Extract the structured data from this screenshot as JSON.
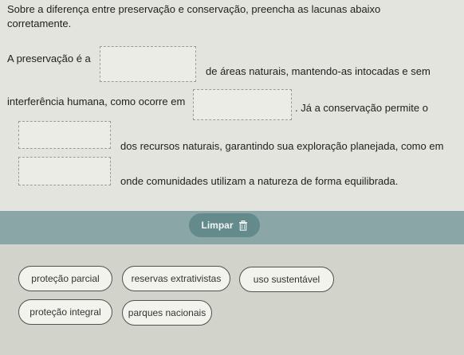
{
  "instructions": {
    "line1": "Sobre a diferença entre preservação e conservação, preencha as lacunas abaixo",
    "line2": "corretamente."
  },
  "sentence": {
    "part1": "A preservação é a",
    "part2": "de áreas naturais, mantendo-as intocadas e sem",
    "part3": "interferência humana, como ocorre em",
    "part4": ". Já a conservação permite o",
    "part5": "dos recursos naturais, garantindo sua exploração planejada, como em",
    "part6": "onde comunidades utilizam a natureza de forma equilibrada."
  },
  "controls": {
    "clear_label": "Limpar",
    "clear_icon": "trash-icon"
  },
  "word_bank": [
    "proteção parcial",
    "reservas extrativistas",
    "uso sustentável",
    "proteção integral",
    "parques nacionais"
  ],
  "colors": {
    "accent": "#648a8c",
    "header_band": "#8aa6a6"
  }
}
